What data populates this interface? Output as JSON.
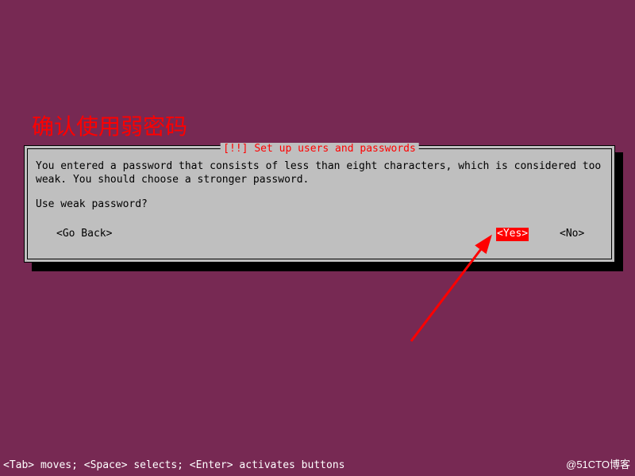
{
  "annotation": {
    "text": "确认使用弱密码"
  },
  "dialog": {
    "title": "[!!] Set up users and passwords",
    "message": "You entered a password that consists of less than eight characters, which is considered too weak. You should choose a stronger password.",
    "question": "Use weak password?",
    "buttons": {
      "go_back": "<Go Back>",
      "yes": "<Yes>",
      "no": "<No>"
    }
  },
  "footer": {
    "hint": "<Tab> moves; <Space> selects; <Enter> activates buttons"
  },
  "watermark": {
    "text": "@51CTO博客"
  }
}
